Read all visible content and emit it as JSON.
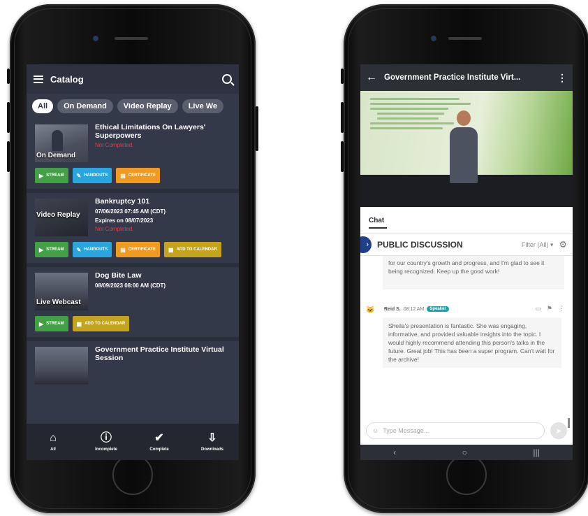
{
  "left": {
    "header": {
      "title": "Catalog",
      "menu_icon": "hamburger-icon",
      "search_icon": "search-icon"
    },
    "filters": [
      "All",
      "On Demand",
      "Video Replay",
      "Live We"
    ],
    "cards": [
      {
        "thumb_label": "On Demand",
        "title": "Ethical Limitations On Lawyers' Superpowers",
        "status": "Not Completed",
        "buttons": [
          "STREAM",
          "HANDOUTS",
          "CERTIFICATE"
        ]
      },
      {
        "thumb_label": "Video Replay",
        "title": "Bankruptcy 101",
        "date": "07/06/2023 07:45 AM (CDT)",
        "expires": "Expires on 08/07/2023",
        "status": "Not Completed",
        "buttons": [
          "STREAM",
          "HANDOUTS",
          "CERTIFICATE",
          "ADD TO CALENDAR"
        ]
      },
      {
        "thumb_label": "Live Webcast",
        "title": "Dog Bite Law",
        "date": "08/09/2023 08:00 AM (CDT)",
        "buttons": [
          "STREAM",
          "ADD TO CALENDAR"
        ]
      },
      {
        "title": "Government Practice Institute Virtual Session"
      }
    ],
    "bottom_nav": [
      {
        "label": "All",
        "icon": "home-icon"
      },
      {
        "label": "Incomplete",
        "icon": "alert-circle-icon"
      },
      {
        "label": "Complete",
        "icon": "check-circle-icon"
      },
      {
        "label": "Downloads",
        "icon": "download-icon"
      }
    ]
  },
  "right": {
    "header": {
      "title": "Government Practice Institute Virt...",
      "back_icon": "back-arrow-icon",
      "more_icon": "kebab-icon"
    },
    "chat_tab": "Chat",
    "discussion": {
      "title": "PUBLIC DISCUSSION",
      "filter": "Filter (All) ▾"
    },
    "message1": "for our country's growth and progress, and I'm glad to see it being recognized. Keep up the good work!",
    "message2": {
      "author": "Reid S.",
      "time": "08:12 AM",
      "badge": "Speaker",
      "text": "Sheila's presentation is fantastic. She was engaging, informative, and provided valuable insights into the topic. I would highly recommend attending this person's talks in the future. Great job! This has been a super program. Can't wait for the archive!"
    },
    "composer_placeholder": "Type Message..."
  },
  "colors": {
    "left_bg": "#34394a",
    "green": "#43a047",
    "blue": "#29a5e0",
    "orange": "#f09a21",
    "olive": "#c4a41c",
    "not_completed": "#d9414f",
    "speaker_badge": "#21a4a8",
    "chevron_blue": "#1f3f87"
  }
}
